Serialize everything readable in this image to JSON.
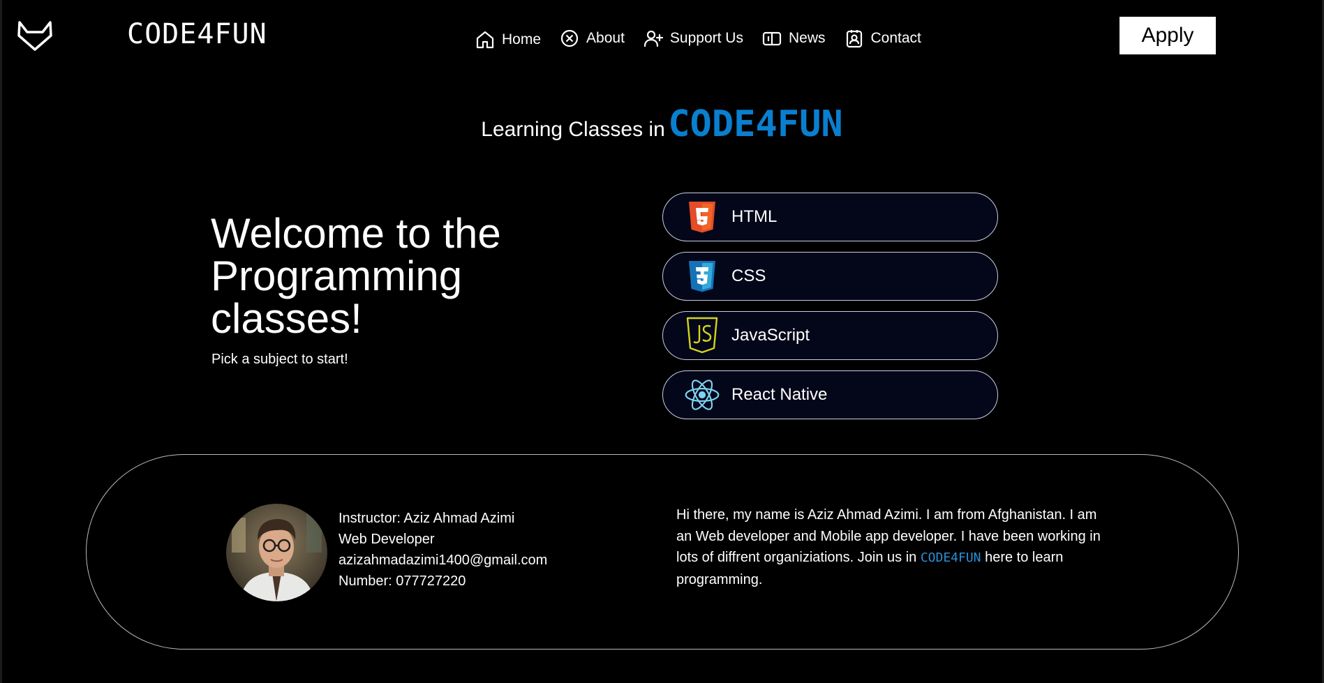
{
  "header": {
    "brand": "CODE4FUN",
    "nav": [
      {
        "label": "Home",
        "icon": "home-icon"
      },
      {
        "label": "About",
        "icon": "about-icon"
      },
      {
        "label": "Support Us",
        "icon": "user-plus-icon"
      },
      {
        "label": "News",
        "icon": "news-icon"
      },
      {
        "label": "Contact",
        "icon": "contact-icon"
      }
    ],
    "apply_label": "Apply"
  },
  "hero": {
    "learning_prefix": "Learning Classes in",
    "learning_brand": "CODE4FUN",
    "welcome": "Welcome to the Programming classes!",
    "pick": "Pick a subject to start!"
  },
  "subjects": [
    {
      "label": "HTML",
      "icon": "html5-icon",
      "color": "#e44d26"
    },
    {
      "label": "CSS",
      "icon": "css3-icon",
      "color": "#1572b6"
    },
    {
      "label": "JavaScript",
      "icon": "js-icon",
      "color": "#d4d41a"
    },
    {
      "label": "React Native",
      "icon": "react-icon",
      "color": "#7fd3f2"
    }
  ],
  "instructor": {
    "name": "Instructor: Aziz Ahmad Azimi",
    "role": "Web Developer",
    "email": "azizahmadazimi1400@gmail.com",
    "phone": "Number: 077727220",
    "bio_before": "Hi there, my name is Aziz Ahmad Azimi. I am from Afghanistan. I am an Web developer and Mobile app developer. I have been working in lots of diffrent organiziations. Join us in ",
    "bio_brand": "CODE4FUN",
    "bio_after": " here to learn programming."
  },
  "colors": {
    "accent": "#0a7fcf",
    "background": "#000000",
    "subject_bg": "#04071a"
  }
}
